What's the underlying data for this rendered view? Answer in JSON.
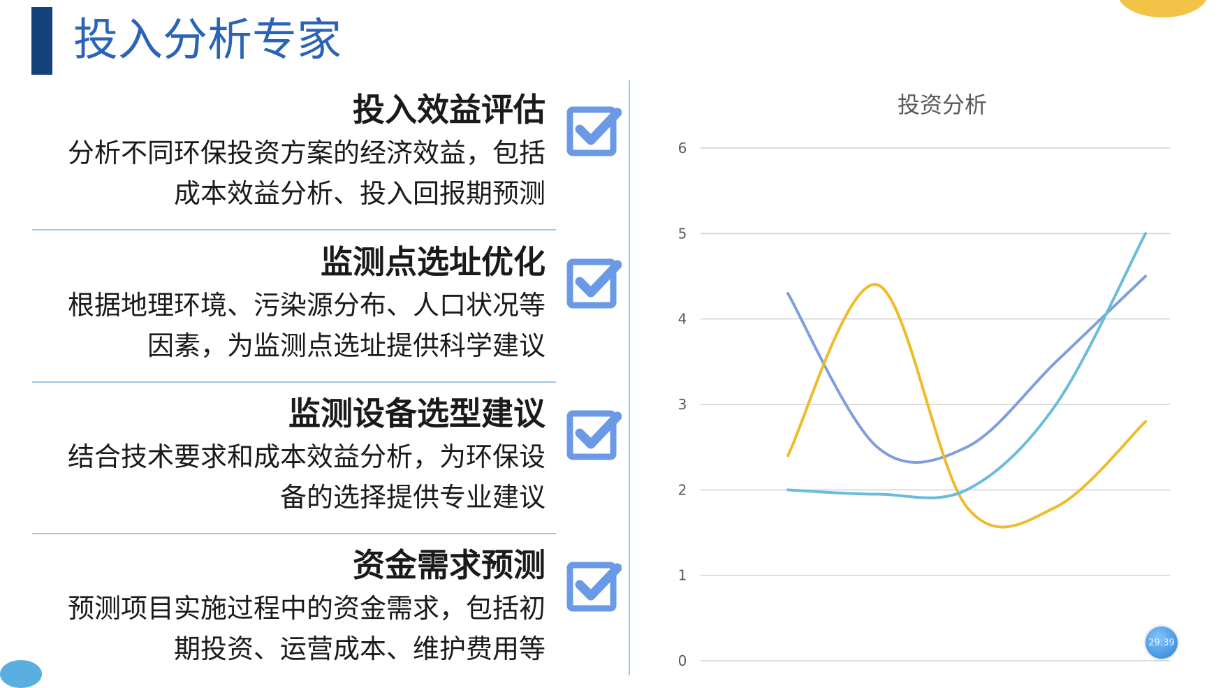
{
  "page": {
    "title": "投入分析专家"
  },
  "items": [
    {
      "heading": "投入效益评估",
      "desc": "分析不同环保投资方案的经济效益，包括成本效益分析、投入回报期预测"
    },
    {
      "heading": "监测点选址优化",
      "desc": "根据地理环境、污染源分布、人口状况等因素，为监测点选址提供科学建议"
    },
    {
      "heading": "监测设备选型建议",
      "desc": "结合技术要求和成本效益分析，为环保设备的选择提供专业建议"
    },
    {
      "heading": "资金需求预测",
      "desc": "预测项目实施过程中的资金需求，包括初期投资、运营成本、维护费用等"
    }
  ],
  "colors": {
    "accent": "#2a63b8",
    "title_bar": "#13427a",
    "divider": "#9cc7e6",
    "check": "#6a9ae6"
  },
  "chart_data": {
    "type": "line",
    "smooth": true,
    "title": "投资分析",
    "ylim": [
      0,
      6
    ],
    "yticks": [
      0,
      1,
      2,
      3,
      4,
      5,
      6
    ],
    "grid": true,
    "x": [
      1,
      2,
      3,
      4,
      5
    ],
    "series": [
      {
        "color": "#7f9fdc",
        "values": [
          4.3,
          2.5,
          2.5,
          3.5,
          4.5
        ]
      },
      {
        "color": "#eebb2a",
        "values": [
          2.4,
          4.4,
          1.8,
          1.8,
          2.8
        ]
      },
      {
        "color": "#6bbcd8",
        "values": [
          2.0,
          1.95,
          2.0,
          3.0,
          5.0
        ]
      }
    ]
  },
  "timer": {
    "text": "29:39"
  }
}
